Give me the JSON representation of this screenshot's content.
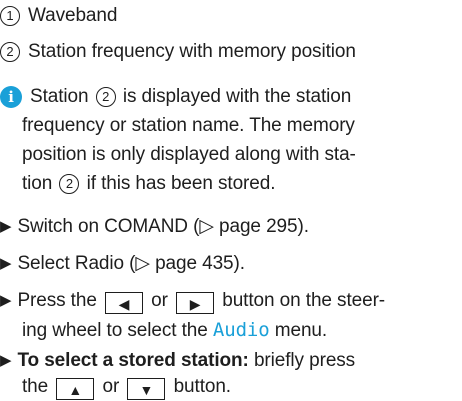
{
  "legend": [
    {
      "marker": "1",
      "text": "Waveband"
    },
    {
      "marker": "2",
      "text": "Station frequency with memory position"
    }
  ],
  "note": {
    "lines": [
      {
        "before": "Station ",
        "marker": "2",
        "after": " is displayed with the station"
      },
      {
        "text": "frequency or station name. The memory"
      },
      {
        "text": "position is only displayed along with sta-"
      },
      {
        "before": "tion ",
        "marker": "2",
        "after": " if this has been stored."
      }
    ]
  },
  "steps": {
    "s1": {
      "text": "Switch on COMAND (▷ page 295)."
    },
    "s2": {
      "text": "Select Radio (▷ page 435)."
    },
    "s3": {
      "pre": "Press the",
      "btn_left": "◀",
      "or": "or",
      "btn_right": "▶",
      "post": "button on the steer-",
      "line2_pre": "ing wheel to select the ",
      "menu": "Audio",
      "line2_post": " menu."
    },
    "s4": {
      "bold": "To select a stored station:",
      "after": " briefly press",
      "line2_pre": "the",
      "btn_up": "▲",
      "or": "or",
      "btn_down": "▼",
      "line2_post": "button."
    }
  }
}
